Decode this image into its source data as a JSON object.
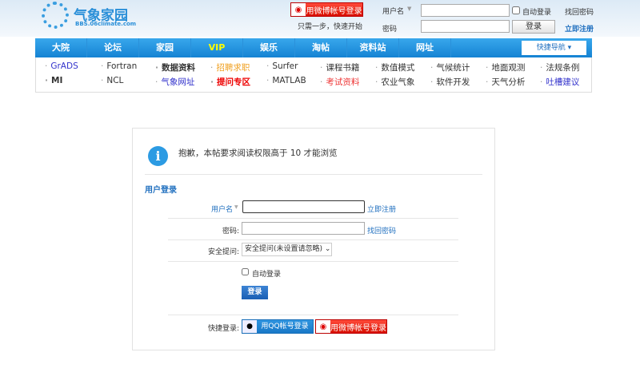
{
  "header": {
    "logo_text": "气象家园",
    "logo_url_text": "BBS.06climate.com",
    "weibo_login": "用微博帐号登录",
    "quick_start": "只需一步，快速开始",
    "username_label": "用户名",
    "password_label": "密码",
    "auto_login": "自动登录",
    "login_button": "登录",
    "forgot_password": "找回密码",
    "register": "立即注册"
  },
  "nav": {
    "items": [
      "大院",
      "论坛",
      "家园",
      "VIP",
      "娱乐",
      "淘帖",
      "资料站",
      "网址"
    ],
    "quick_nav": "快捷导航"
  },
  "subnav": {
    "row1": [
      "GrADS",
      "Fortran",
      "数据资料",
      "招聘求职",
      "Surfer",
      "课程书籍",
      "数值模式",
      "气候统计",
      "地面观测",
      "法规条例"
    ],
    "row2": [
      "MI",
      "NCL",
      "气象网址",
      "提问专区",
      "MATLAB",
      "考试资料",
      "农业气象",
      "软件开发",
      "天气分析",
      "吐槽建议"
    ]
  },
  "notice": {
    "message": "抱歉，本帖要求阅读权限高于 10 才能浏览"
  },
  "login": {
    "title": "用户登录",
    "username_label": "用户名",
    "register_link": "立即注册",
    "password_label": "密码:",
    "forgot_link": "找回密码",
    "security_label": "安全提问:",
    "security_value": "安全提问(未设置请忽略)",
    "auto_login": "自动登录",
    "submit": "登录",
    "quick_label": "快捷登录:",
    "qq_button": "用QQ帐号登录",
    "weibo_button": "用微博帐号登录"
  }
}
